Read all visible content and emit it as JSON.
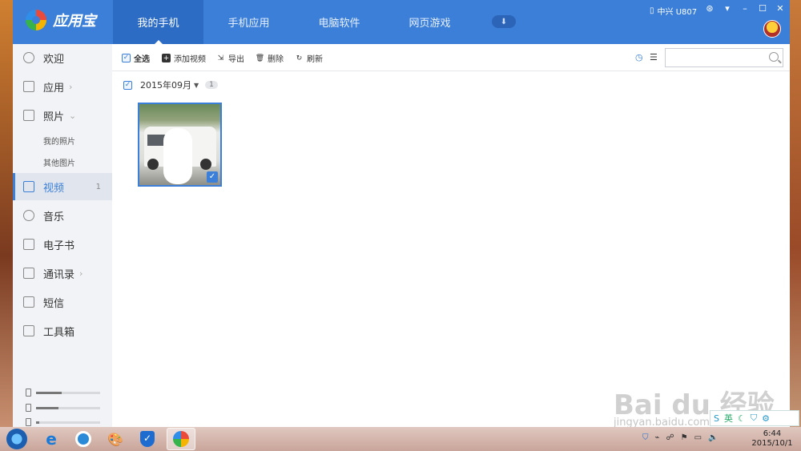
{
  "app": {
    "name": "应用宝",
    "tabs": [
      "我的手机",
      "手机应用",
      "电脑软件",
      "网页游戏"
    ],
    "active_tab": 0,
    "device": "中兴 U807"
  },
  "sidebar": {
    "items": [
      {
        "label": "欢迎",
        "icon": "welcome-icon",
        "arrow": ""
      },
      {
        "label": "应用",
        "icon": "apps-grid-icon",
        "arrow": "›"
      },
      {
        "label": "照片",
        "icon": "photo-icon",
        "arrow": "⌄"
      },
      {
        "label": "视频",
        "icon": "video-icon",
        "arrow": "",
        "count": "1"
      },
      {
        "label": "音乐",
        "icon": "music-icon",
        "arrow": ""
      },
      {
        "label": "电子书",
        "icon": "ebook-icon",
        "arrow": ""
      },
      {
        "label": "通讯录",
        "icon": "contacts-icon",
        "arrow": "›"
      },
      {
        "label": "短信",
        "icon": "sms-icon",
        "arrow": ""
      },
      {
        "label": "工具箱",
        "icon": "toolbox-icon",
        "arrow": ""
      }
    ],
    "sub_items": [
      "我的照片",
      "其他图片"
    ],
    "storage_levels": [
      0.4,
      0.35,
      0.05
    ]
  },
  "toolbar": {
    "select_all": "全选",
    "add_video": "添加视频",
    "export": "导出",
    "delete": "删除",
    "refresh": "刷新",
    "search_placeholder": ""
  },
  "group": {
    "date": "2015年09月",
    "count": "1"
  },
  "watermark": {
    "main": "Bai du 经验",
    "sub": "jingyan.baidu.com"
  },
  "ime": {
    "lang": "英"
  },
  "taskbar": {
    "time": "6:44",
    "date": "2015/10/1"
  },
  "colors": {
    "accent": "#3b7fd8",
    "topbar": "#3b7fd8",
    "sidebar": "#f1f3f6"
  }
}
